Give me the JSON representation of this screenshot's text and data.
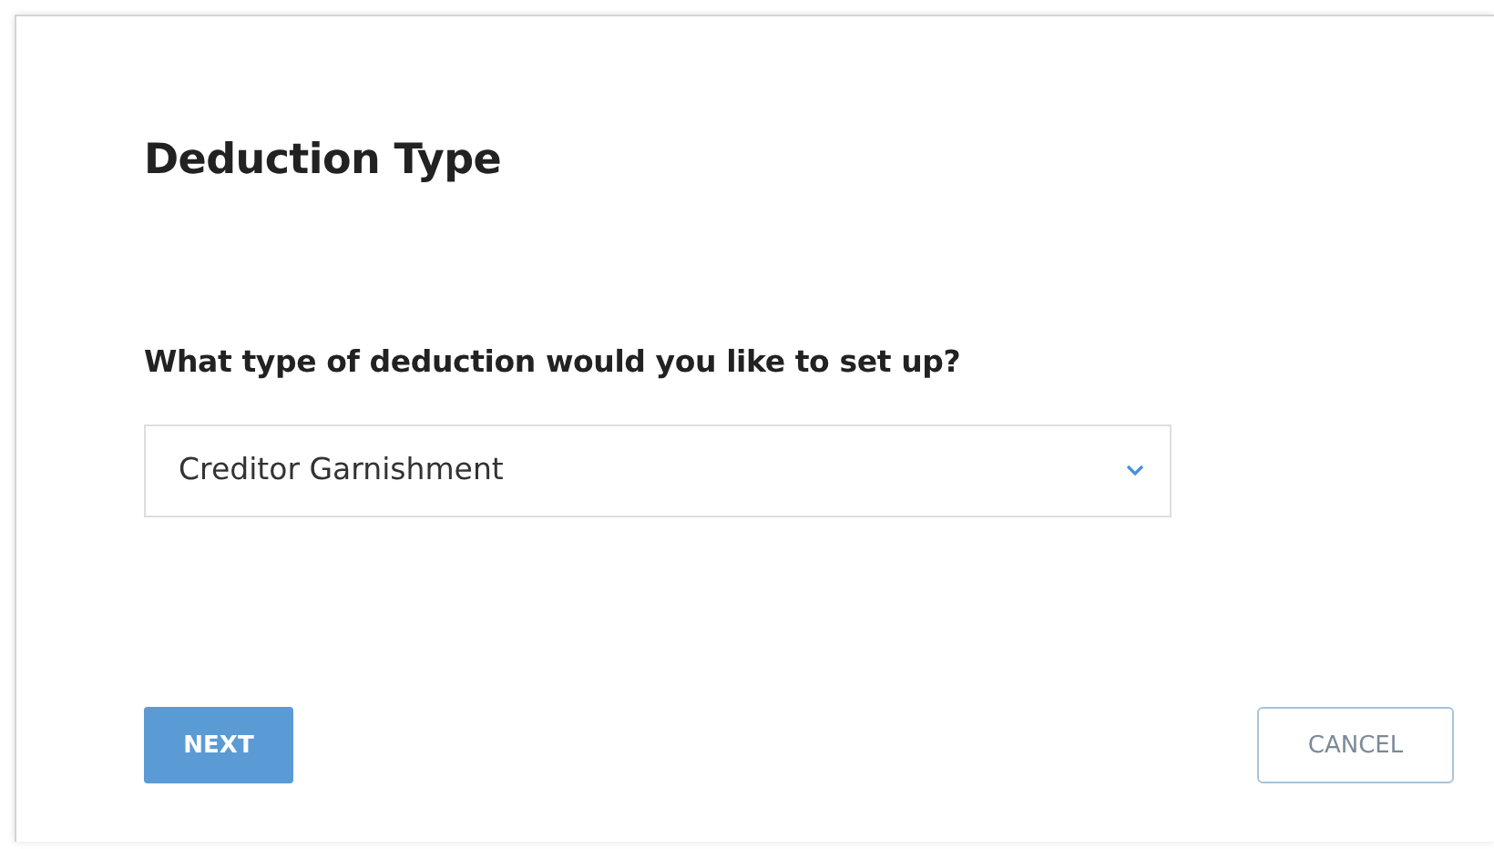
{
  "title": "Deduction Type",
  "question": "What type of deduction would you like to set up?",
  "select": {
    "value": "Creditor Garnishment"
  },
  "buttons": [
    {
      "label": "NEXT",
      "kind": "primary"
    },
    {
      "label": "CANCEL",
      "kind": "secondary"
    }
  ]
}
